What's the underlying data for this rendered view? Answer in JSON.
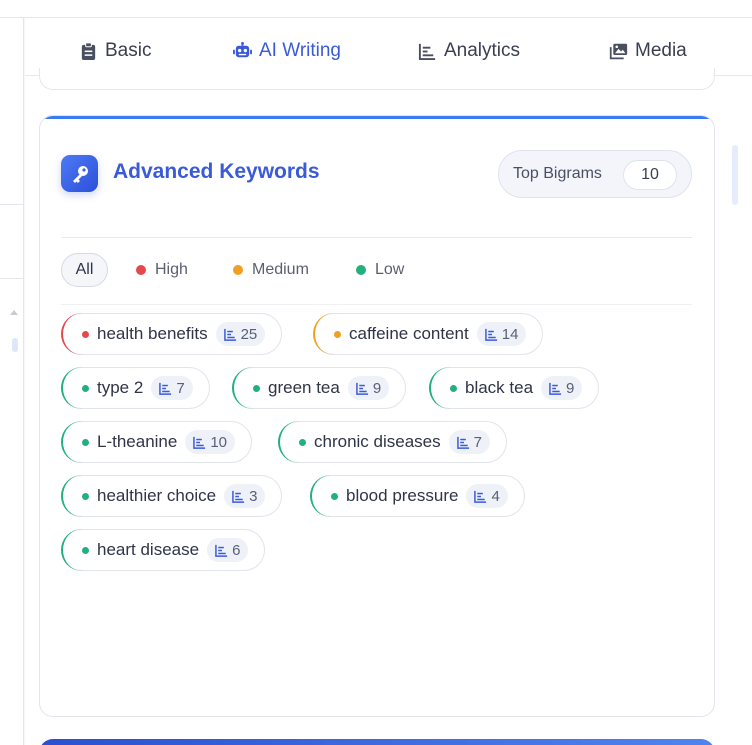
{
  "tabs": [
    {
      "id": "basic",
      "label": "Basic",
      "icon": "clipboard-icon",
      "active": false
    },
    {
      "id": "ai-writing",
      "label": "AI Writing",
      "icon": "robot-icon",
      "active": true
    },
    {
      "id": "analytics",
      "label": "Analytics",
      "icon": "chart-icon",
      "active": false
    },
    {
      "id": "media",
      "label": "Media",
      "icon": "images-icon",
      "active": false
    }
  ],
  "card": {
    "title": "Advanced Keywords",
    "icon": "key-icon",
    "bigram_label": "Top Bigrams",
    "bigram_count": "10"
  },
  "filters": [
    {
      "label": "All",
      "color": ""
    },
    {
      "label": "High",
      "color": "#e5484d"
    },
    {
      "label": "Medium",
      "color": "#f0a020"
    },
    {
      "label": "Low",
      "color": "#22b07d"
    }
  ],
  "keywords": [
    {
      "text": "health benefits",
      "count": "25",
      "level": "high"
    },
    {
      "text": "caffeine content",
      "count": "14",
      "level": "medium"
    },
    {
      "text": "type 2",
      "count": "7",
      "level": "low"
    },
    {
      "text": "green tea",
      "count": "9",
      "level": "low"
    },
    {
      "text": "black tea",
      "count": "9",
      "level": "low"
    },
    {
      "text": "L-theanine",
      "count": "10",
      "level": "low"
    },
    {
      "text": "chronic diseases",
      "count": "7",
      "level": "low"
    },
    {
      "text": "healthier choice",
      "count": "3",
      "level": "low"
    },
    {
      "text": "blood pressure",
      "count": "4",
      "level": "low"
    },
    {
      "text": "heart disease",
      "count": "6",
      "level": "low"
    }
  ],
  "colors": {
    "accent": "#3a5bd9",
    "high": "#e5484d",
    "medium": "#f0a020",
    "low": "#22b07d"
  }
}
